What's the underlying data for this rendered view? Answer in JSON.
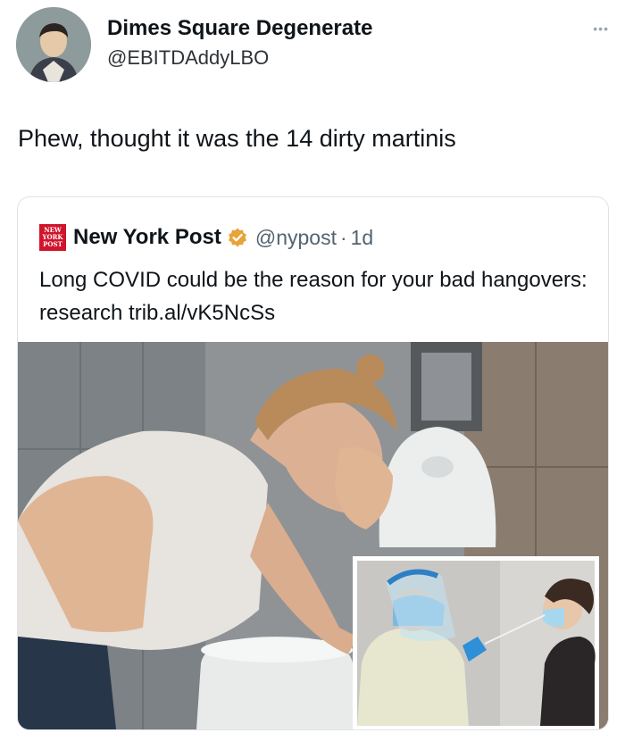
{
  "tweet": {
    "display_name": "Dimes Square Degenerate",
    "handle": "@EBITDAddyLBO",
    "more_icon": "more-dots-icon",
    "text": "Phew, thought it was the 14 dirty martinis"
  },
  "quoted": {
    "logo_lines": [
      "NEW",
      "YORK",
      "POST"
    ],
    "name": "New York Post",
    "verified_icon": "verified-badge-icon",
    "handle": "@nypost",
    "separator": "·",
    "time": "1d",
    "text": "Long COVID could be the reason for your bad hangovers: research trib.al/vK5NcSs"
  },
  "colors": {
    "brand_red": "#d0142c",
    "verified_gold": "#e8a33a",
    "text_primary": "#0f1419",
    "text_secondary": "#536471"
  }
}
